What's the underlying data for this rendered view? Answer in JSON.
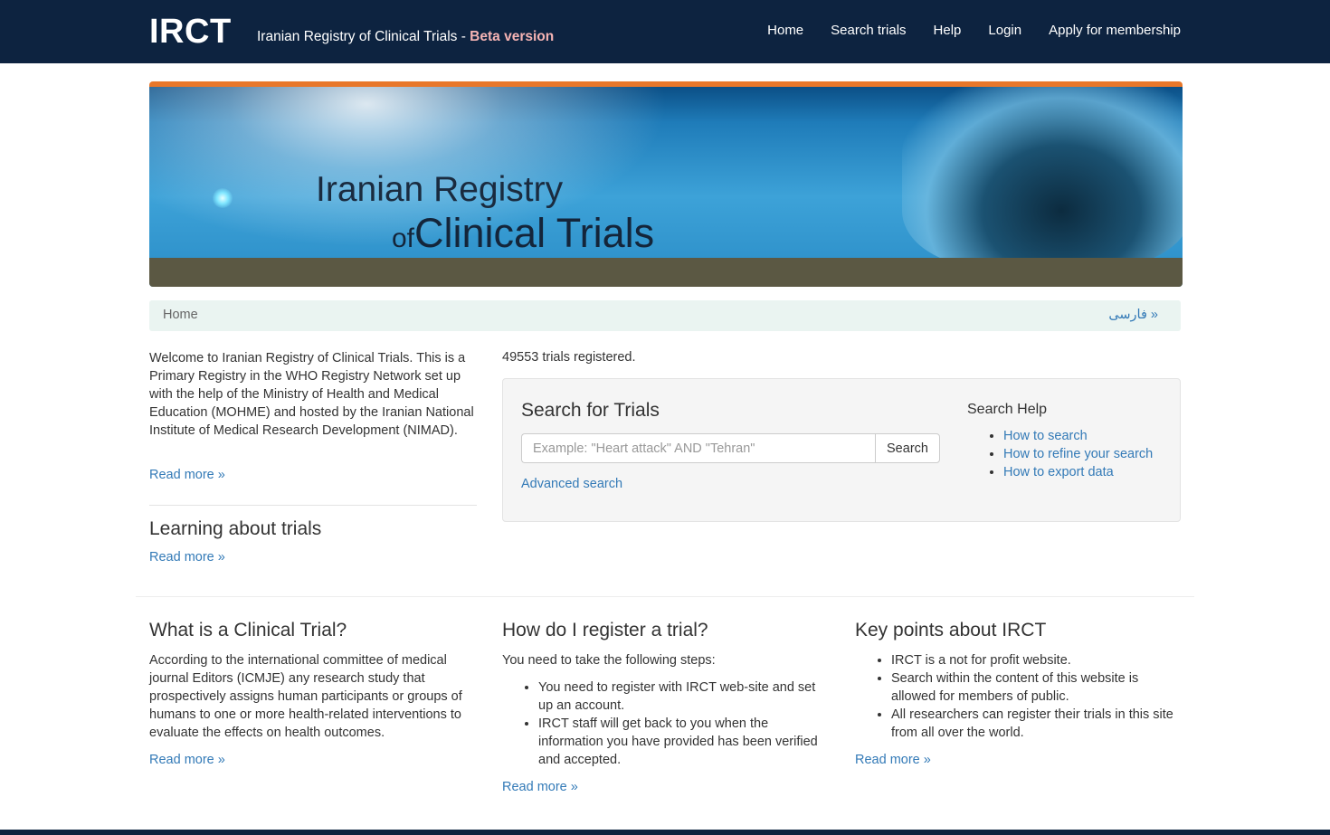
{
  "header": {
    "brand": "IRCT",
    "tagline": "Iranian Registry of Clinical Trials -",
    "beta": "Beta version",
    "nav": [
      "Home",
      "Search trials",
      "Help",
      "Login",
      "Apply for membership"
    ]
  },
  "banner": {
    "line1": "Iranian Registry",
    "line2_of": "of",
    "line2": "Clinical Trials"
  },
  "breadcrumb": {
    "home": "Home",
    "language_link": "« فارسی"
  },
  "welcome": {
    "text": "Welcome to Iranian Registry of Clinical Trials. This is a Primary Registry in the WHO Registry Network set up with the help of the Ministry of Health and Medical Education (MOHME) and hosted by the Iranian National Institute of Medical Research Development (NIMAD).",
    "read_more": "Read more »"
  },
  "learning": {
    "title": "Learning about trials",
    "read_more": "Read more »"
  },
  "search": {
    "count_text": "49553 trials registered.",
    "title": "Search for Trials",
    "placeholder": "Example: \"Heart attack\" AND \"Tehran\"",
    "value": "",
    "button": "Search",
    "advanced": "Advanced search",
    "help_title": "Search Help",
    "help_links": [
      "How to search",
      "How to refine your search",
      "How to export data"
    ]
  },
  "clinical_trial": {
    "title": "What is a Clinical Trial?",
    "text": "According to the international committee of medical journal Editors (ICMJE) any research study that prospectively assigns human participants or groups of humans to one or more health-related interventions to evaluate the effects on health outcomes.",
    "read_more": "Read more »"
  },
  "register": {
    "title": "How do I register a trial?",
    "intro": "You need to take the following steps:",
    "steps": [
      "You need to register with IRCT web-site and set up an account.",
      "IRCT staff will get back to you when the information you have provided has been verified and accepted."
    ],
    "read_more": "Read more »"
  },
  "key_points": {
    "title": "Key points about IRCT",
    "points": [
      "IRCT is a not for profit website.",
      "Search within the content of this website is allowed for members of public.",
      "All researchers can register their trials in this site from all over the world."
    ],
    "read_more": "Read more »"
  },
  "colors": {
    "header_bg": "#0d2340",
    "link": "#337ab7",
    "beta": "#f6b4b4",
    "banner_top": "#e8772a",
    "breadcrumb_bg": "#eaf4f1"
  }
}
